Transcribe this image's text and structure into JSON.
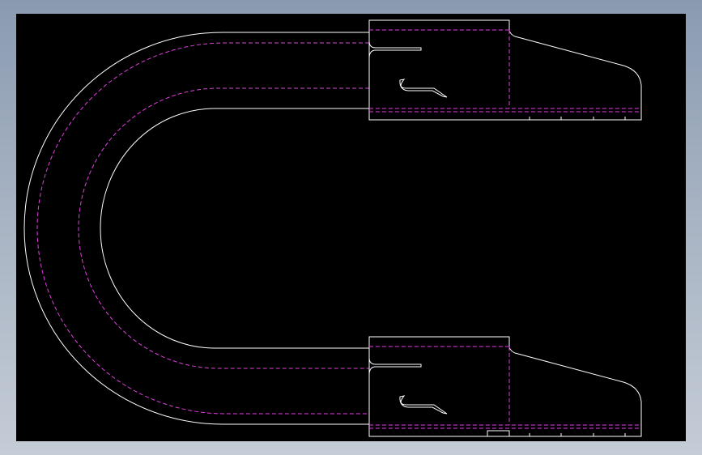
{
  "colors": {
    "viewport_background": "#000000",
    "outline": "#ffffff",
    "hidden_line": "#e040e0"
  },
  "drawing": {
    "line_types": [
      "visible-outline",
      "hidden-dashed"
    ]
  }
}
